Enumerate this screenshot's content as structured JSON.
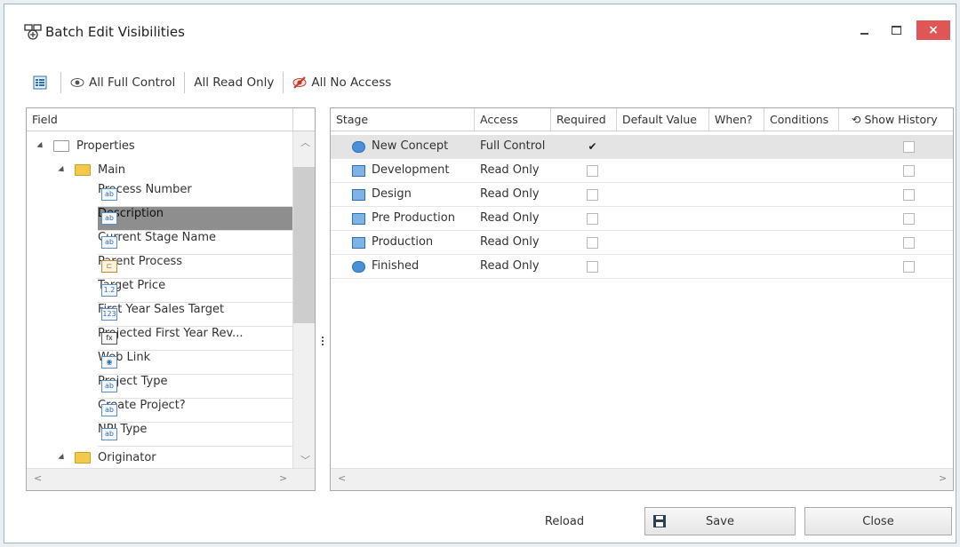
{
  "window": {
    "title": "Batch Edit Visibilities",
    "close_glyph": "×"
  },
  "toolbar": {
    "all_full_control": "All Full Control",
    "all_read_only": "All Read Only",
    "all_no_access": "All No Access"
  },
  "left_panel": {
    "header": "Field",
    "tree": [
      {
        "label": "Properties",
        "level": 0,
        "type": "folder-outline"
      },
      {
        "label": "Main",
        "level": 1,
        "type": "folder-open"
      }
    ],
    "fields": [
      {
        "label": "Process Number",
        "icon": "text-field-icon",
        "glyph": "ab"
      },
      {
        "label": "Description",
        "icon": "text-field-icon",
        "glyph": "ab",
        "selected": true
      },
      {
        "label": "Current Stage Name",
        "icon": "text-field-icon",
        "glyph": "ab"
      },
      {
        "label": "Parent Process",
        "icon": "process-link-icon",
        "glyph": "⊏"
      },
      {
        "label": "Target Price",
        "icon": "number-field-icon",
        "glyph": "1.2"
      },
      {
        "label": "First Year Sales Target",
        "icon": "integer-field-icon",
        "glyph": "123"
      },
      {
        "label": "Projected First Year Rev...",
        "icon": "formula-field-icon",
        "glyph": "fx"
      },
      {
        "label": "Web Link",
        "icon": "web-link-icon",
        "glyph": "◉"
      },
      {
        "label": "Project Type",
        "icon": "text-field-icon",
        "glyph": "ab"
      },
      {
        "label": "Create Project?",
        "icon": "text-field-icon",
        "glyph": "ab"
      },
      {
        "label": "NPI Type",
        "icon": "text-field-icon",
        "glyph": "ab"
      }
    ],
    "trailing_folder": "Originator"
  },
  "right_panel": {
    "columns": {
      "stage": "Stage",
      "access": "Access",
      "required": "Required",
      "default_value": "Default Value",
      "when": "When?",
      "conditions": "Conditions",
      "show_history": "Show History"
    },
    "rows": [
      {
        "stage": "New Concept",
        "access": "Full Control",
        "required": true,
        "icon": "circle",
        "active": true
      },
      {
        "stage": "Development",
        "access": "Read Only",
        "required": false,
        "icon": "rect"
      },
      {
        "stage": "Design",
        "access": "Read Only",
        "required": false,
        "icon": "rect"
      },
      {
        "stage": "Pre Production",
        "access": "Read Only",
        "required": false,
        "icon": "rect"
      },
      {
        "stage": "Production",
        "access": "Read Only",
        "required": false,
        "icon": "rect"
      },
      {
        "stage": "Finished",
        "access": "Read Only",
        "required": false,
        "icon": "circle"
      }
    ]
  },
  "footer": {
    "reload": "Reload",
    "save": "Save",
    "close": "Close"
  },
  "colors": {
    "accent": "#4a90d9",
    "close_button": "#e05555",
    "selected_row": "#8e8e8e"
  }
}
